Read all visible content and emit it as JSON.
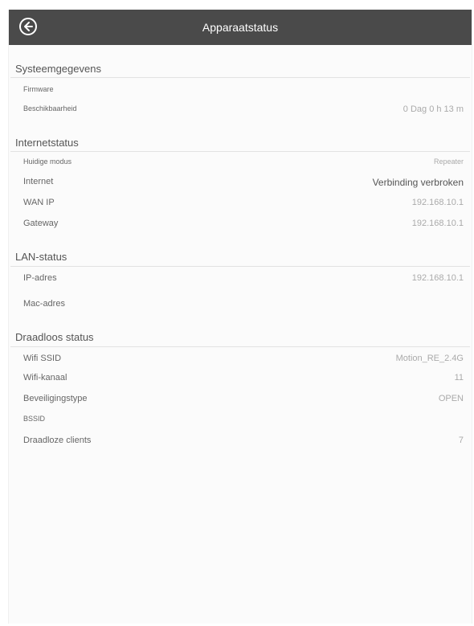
{
  "header": {
    "title": "Apparaatstatus"
  },
  "sections": {
    "system": {
      "title": "Systeemgegevens",
      "rows": [
        {
          "label": "Firmware",
          "value": ""
        },
        {
          "label": "Beschikbaarheid",
          "value": "0 Dag 0 h 13 m"
        }
      ]
    },
    "internet": {
      "title": "Internetstatus",
      "rows": [
        {
          "label": "Huidige modus",
          "value": "Repeater"
        },
        {
          "label": "Internet",
          "value": "Verbinding verbroken"
        },
        {
          "label": "WAN IP",
          "value": "192.168.10.1"
        },
        {
          "label": "Gateway",
          "value": "192.168.10.1"
        }
      ]
    },
    "lan": {
      "title": "LAN-status",
      "rows": [
        {
          "label": "IP-adres",
          "value": "192.168.10.1"
        },
        {
          "label": "Mac-adres",
          "value": ""
        }
      ]
    },
    "wireless": {
      "title": "Draadloos status",
      "rows": [
        {
          "label": "Wifi SSID",
          "value": "Motion_RE_2.4G"
        },
        {
          "label": "Wifi-kanaal",
          "value": "11"
        },
        {
          "label": "Beveiligingstype",
          "value": "OPEN"
        },
        {
          "label": "BSSID",
          "value": ""
        },
        {
          "label": "Draadloze clients",
          "value": "7"
        }
      ]
    }
  },
  "colors": {
    "topbar": "#4a4a4a",
    "background": "#fbfbfb",
    "divider": "#e2e2e2"
  },
  "icons": {
    "back": "back-arrow-circle-icon"
  }
}
